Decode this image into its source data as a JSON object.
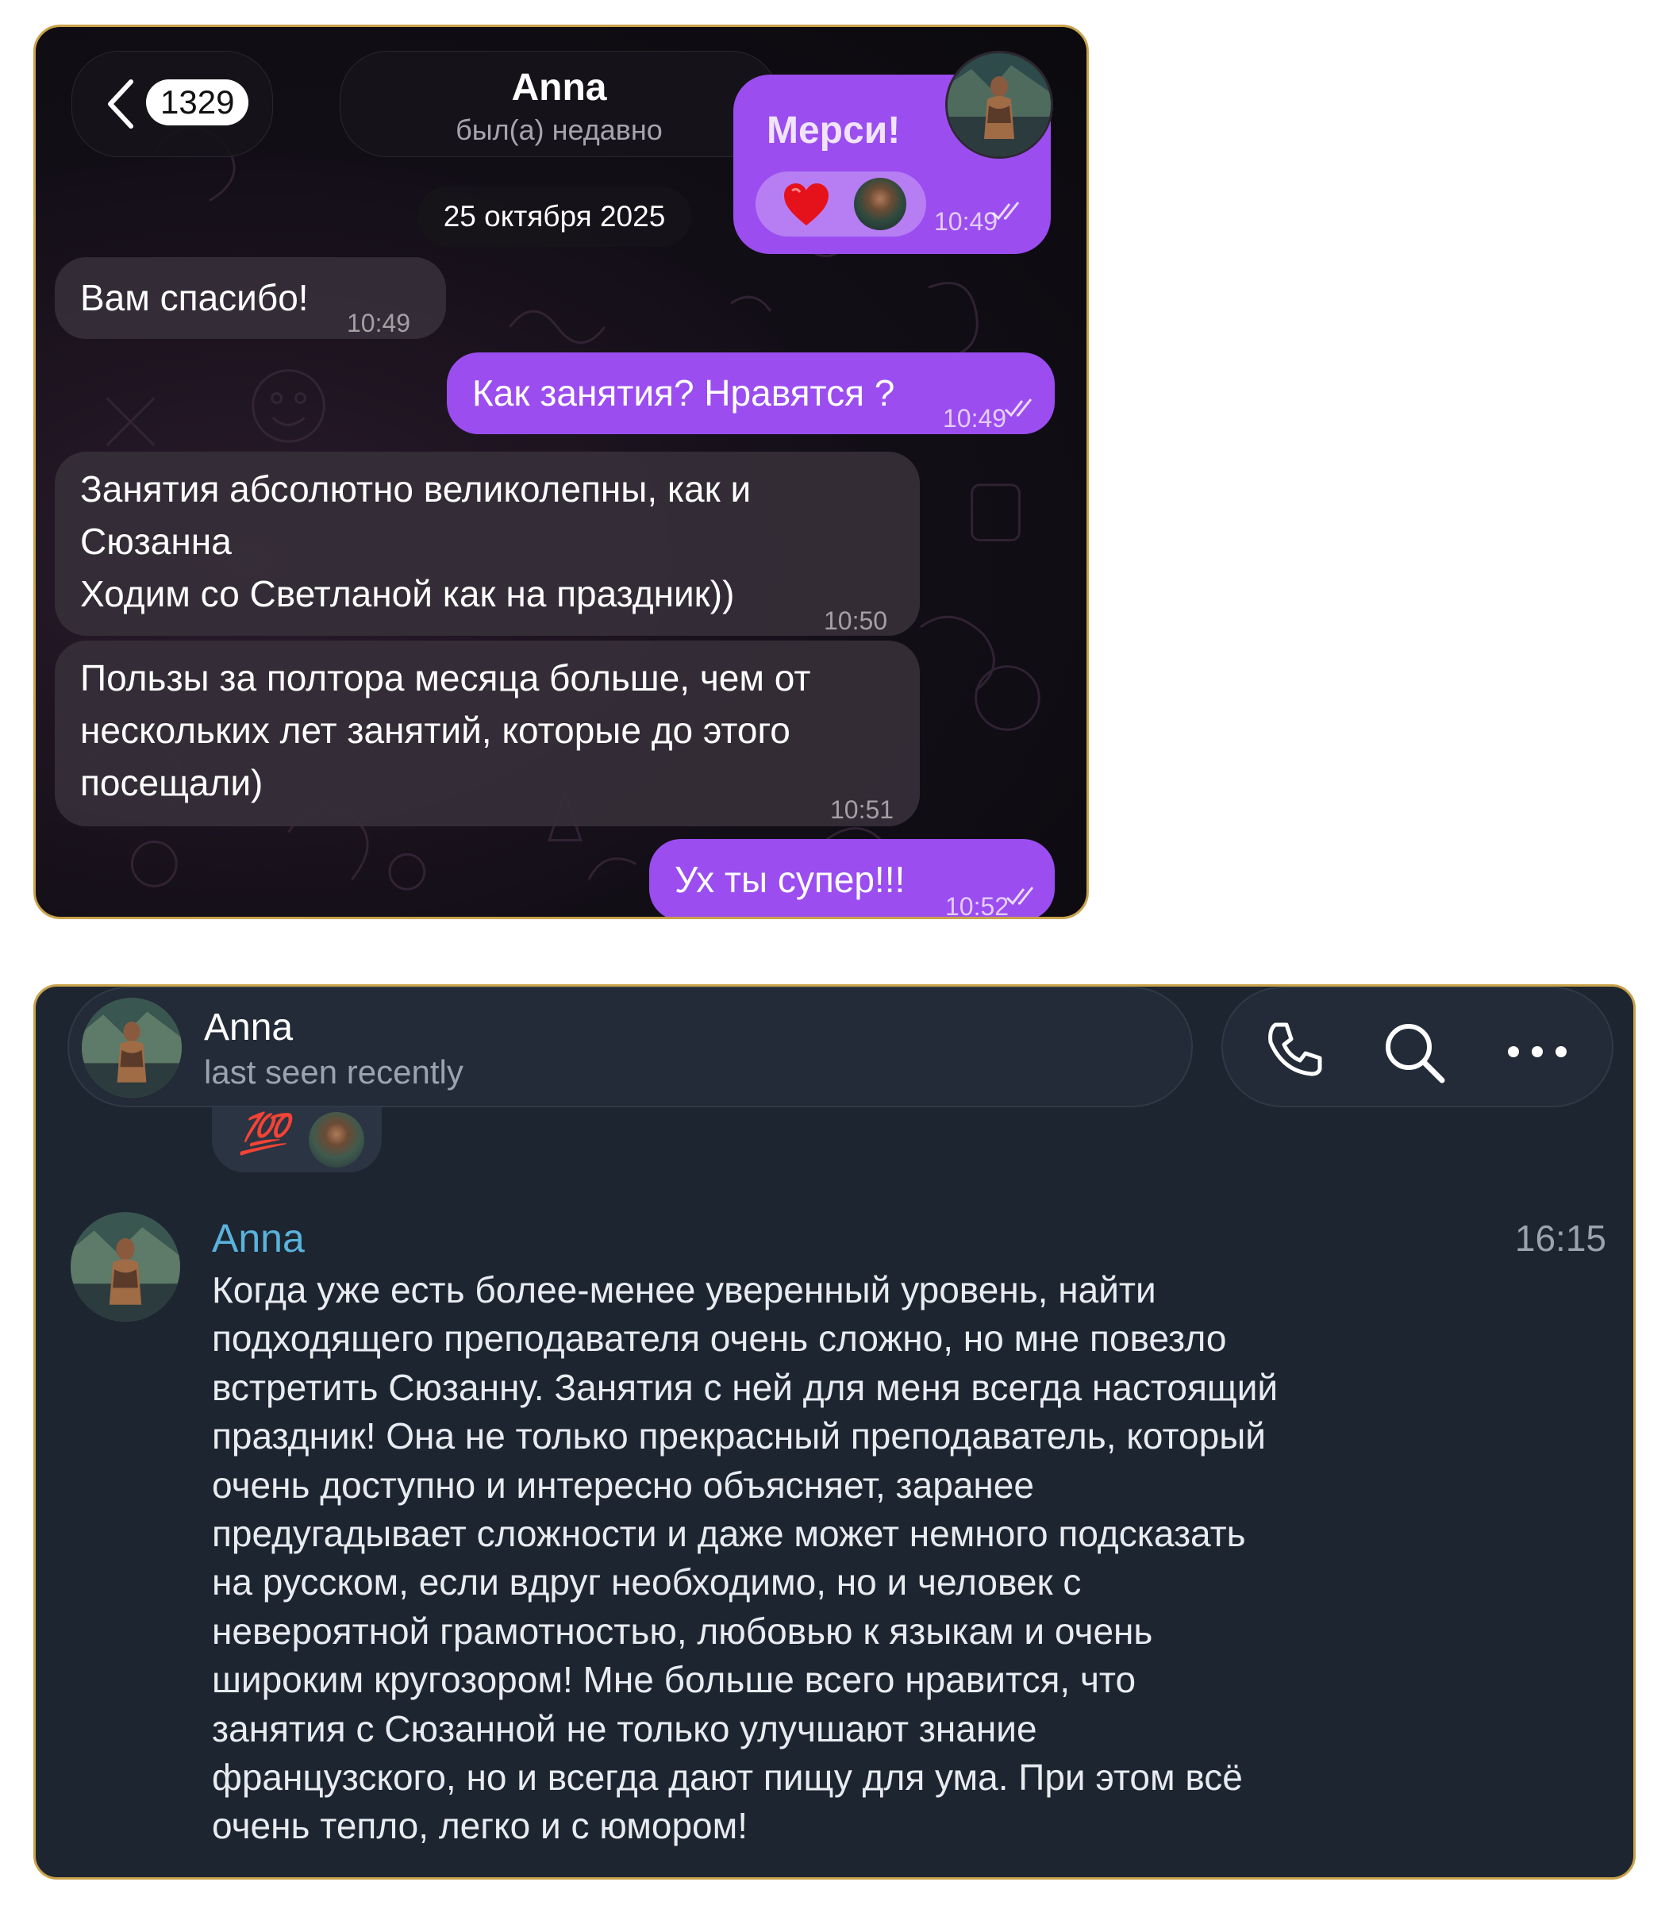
{
  "top_chat": {
    "back": {
      "unread_count": "1329"
    },
    "header": {
      "name": "Anna",
      "status": "был(а) недавно"
    },
    "partial_message": {
      "text": "Мерси!",
      "reaction_emoji": "red-heart",
      "time": "10:49",
      "read": true
    },
    "date_label": "25 октября 2025",
    "messages": [
      {
        "direction": "in",
        "text": "Вам спасибо!",
        "time": "10:49"
      },
      {
        "direction": "out",
        "text": "Как занятия? Нравятся ?",
        "time": "10:49",
        "read": true
      },
      {
        "direction": "in",
        "text": "Занятия абсолютно великолепны, как и\nСюзанна\nХодим со Светланой как на праздник))",
        "time": "10:50"
      },
      {
        "direction": "in",
        "text": "Пользы за полтора месяца больше, чем от\nнескольких лет занятий, которые до этого\nпосещали)",
        "time": "10:51"
      },
      {
        "direction": "out",
        "text": "Ух ты супер!!!",
        "time": "10:52",
        "read": true
      }
    ],
    "colors": {
      "outgoing_bubble": "#9b4df0",
      "incoming_bubble": "#362e38",
      "background": "#120e16"
    }
  },
  "bottom_chat": {
    "header": {
      "name": "Anna",
      "status": "last seen recently"
    },
    "actions": [
      {
        "icon": "phone-icon"
      },
      {
        "icon": "search-icon"
      },
      {
        "icon": "more-icon"
      }
    ],
    "reaction": {
      "emoji": "100",
      "label": "💯"
    },
    "message": {
      "author": "Anna",
      "time": "16:15",
      "text": "Когда уже есть более-менее уверенный уровень, найти\nподходящего преподавателя очень сложно, но мне повезло\nвстретить Сюзанну. Занятия с ней для меня всегда настоящий\nпраздник! Она не только прекрасный преподаватель, который\nочень доступно и интересно объясняет, заранее\nпредугадывает сложности и даже может немного подсказать\nна русском, если вдруг необходимо, но и человек с\nневероятной грамотностью, любовью к языкам и очень\nшироким кругозором! Мне больше всего нравится, что\nзанятия с Сюзанной не только улучшают знание\nфранцузского, но и всегда дают пищу для ума. При этом всё\nочень тепло, легко и с юмором!"
    },
    "colors": {
      "background": "#1d2530",
      "author_name": "#5ab3dc"
    }
  }
}
